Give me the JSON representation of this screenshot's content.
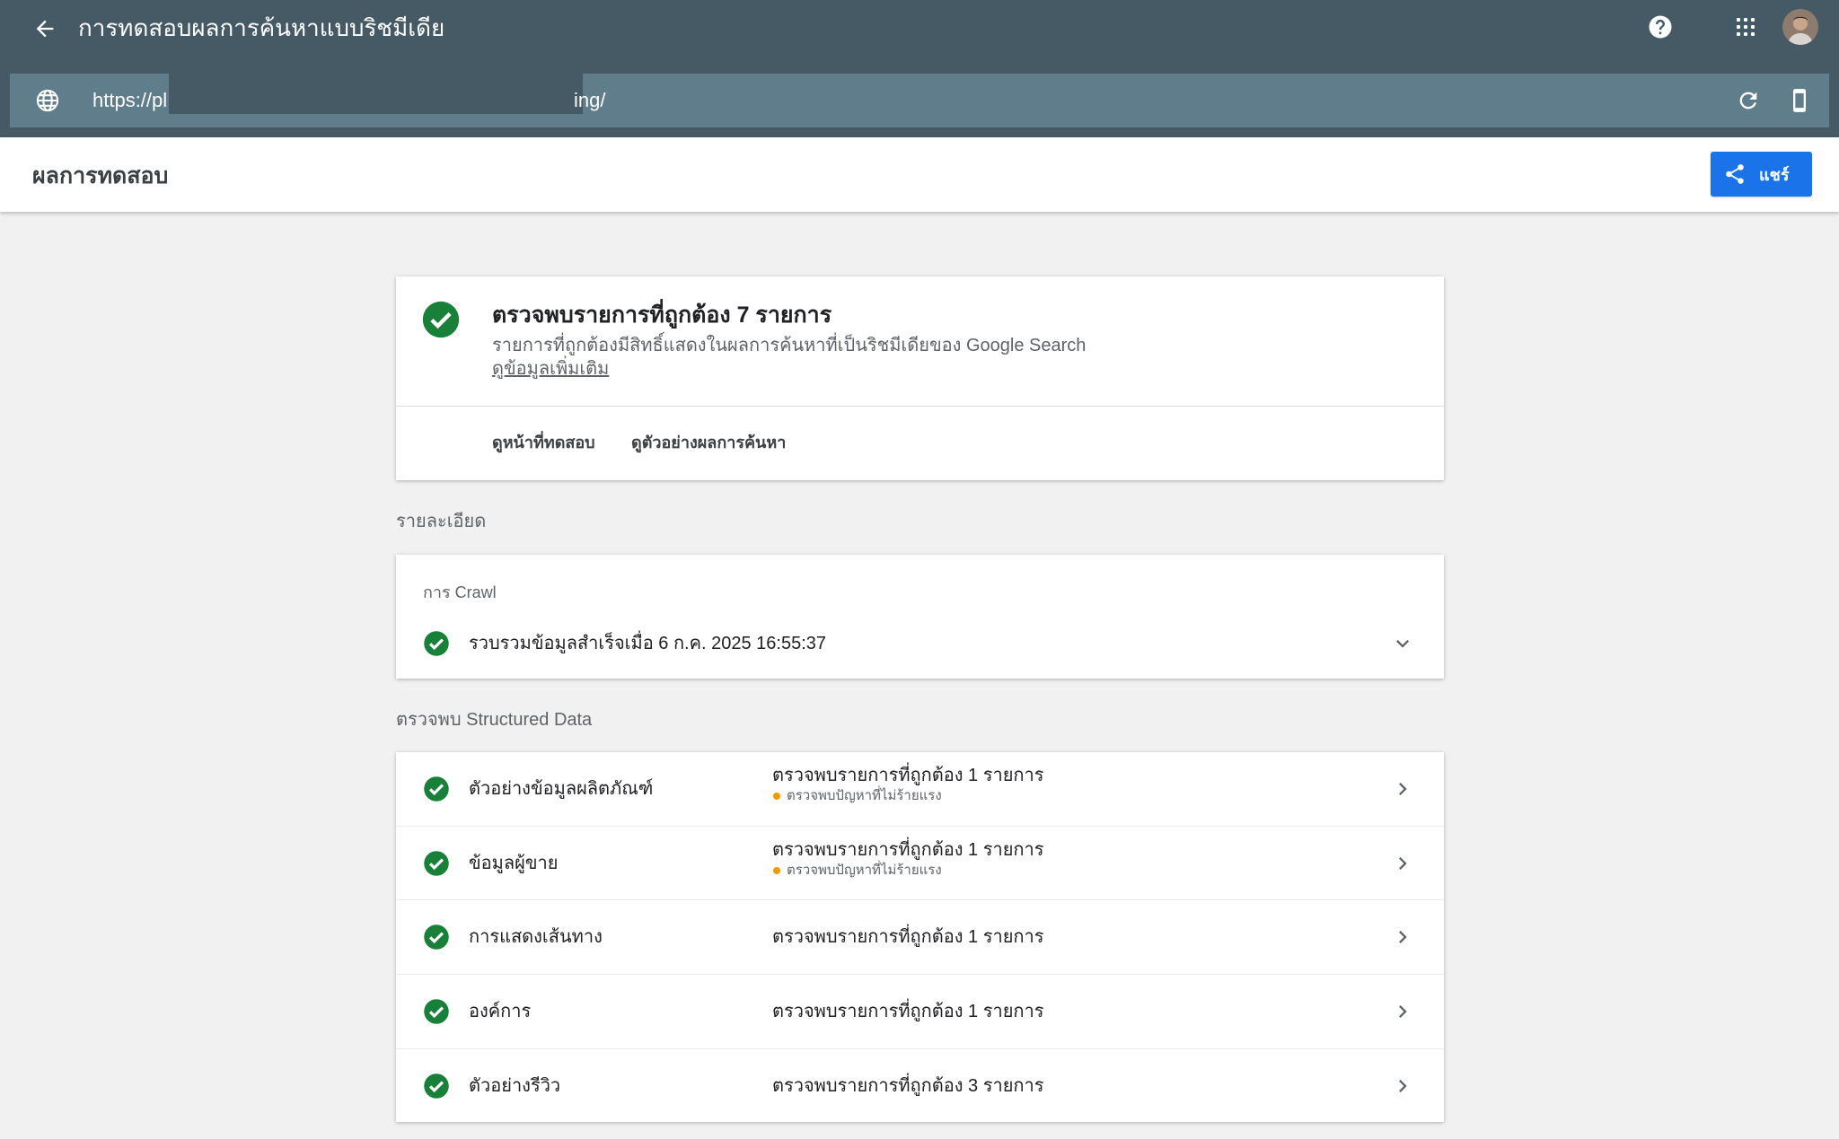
{
  "header": {
    "title": "การทดสอบผลการค้นหาแบบริชมีเดีย",
    "url_prefix": "https://pl",
    "url_suffix": "ing/"
  },
  "subheader": {
    "title": "ผลการทดสอบ",
    "share_label": "แชร์"
  },
  "summary": {
    "heading": "ตรวจพบรายการที่ถูกต้อง 7 รายการ",
    "description": "รายการที่ถูกต้องมีสิทธิ์แสดงในผลการค้นหาที่เป็นริชมีเดียของ Google Search",
    "learn_more": "ดูข้อมูลเพิ่มเติม",
    "view_tested_page": "ดูหน้าที่ทดสอบ",
    "preview_results": "ดูตัวอย่างผลการค้นหา"
  },
  "details": {
    "section_label": "รายละเอียด",
    "crawl_label": "การ Crawl",
    "crawl_status": "รวบรวมข้อมูลสำเร็จเมื่อ 6 ก.ค. 2025 16:55:37"
  },
  "structured_data": {
    "section_label": "ตรวจพบ Structured Data",
    "items": [
      {
        "name": "ตัวอย่างข้อมูลผลิตภัณฑ์",
        "status": "ตรวจพบรายการที่ถูกต้อง 1 รายการ",
        "warning": "ตรวจพบปัญหาที่ไม่ร้ายแรง"
      },
      {
        "name": "ข้อมูลผู้ขาย",
        "status": "ตรวจพบรายการที่ถูกต้อง 1 รายการ",
        "warning": "ตรวจพบปัญหาที่ไม่ร้ายแรง"
      },
      {
        "name": "การแสดงเส้นทาง",
        "status": "ตรวจพบรายการที่ถูกต้อง 1 รายการ"
      },
      {
        "name": "องค์การ",
        "status": "ตรวจพบรายการที่ถูกต้อง 1 รายการ"
      },
      {
        "name": "ตัวอย่างรีวิว",
        "status": "ตรวจพบรายการที่ถูกต้อง 3 รายการ"
      }
    ]
  },
  "colors": {
    "appbar": "#455a64",
    "urlbar": "#607d8b",
    "accent": "#1a73e8",
    "success": "#188038",
    "warning": "#f29900"
  },
  "icons": {
    "back": "arrow-left-icon",
    "help": "help-circle-icon",
    "apps": "apps-grid-icon",
    "globe": "globe-icon",
    "reload": "reload-icon",
    "device": "smartphone-icon",
    "share": "share-icon",
    "check": "check-circle-icon",
    "chevron_down": "chevron-down-icon",
    "chevron_right": "chevron-right-icon"
  }
}
